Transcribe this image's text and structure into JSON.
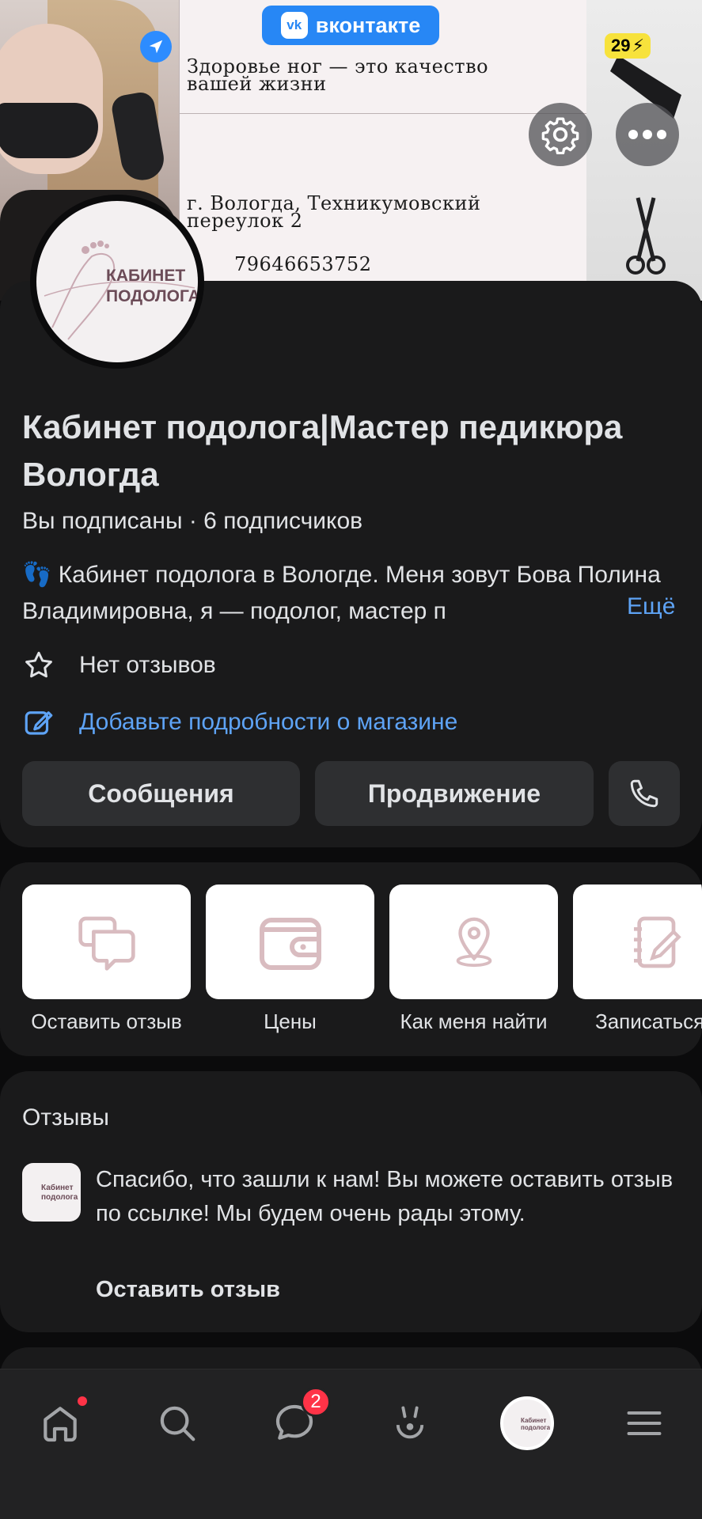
{
  "status_bar": {
    "battery": "29"
  },
  "cover": {
    "badge_label": "вконтакте",
    "slogan": "Здоровье ног — это качество вашей жизни",
    "address": "г. Вологда, Техникумовский переулок 2",
    "phone": "79646653752"
  },
  "avatar": {
    "text": "КАБИНЕТ ПОДОЛОГА"
  },
  "group": {
    "title": "Кабинет подолога|Мастер педикюра Вологда",
    "subscription_status": "Вы подписаны",
    "subscribers": "6 подписчиков",
    "description": "👣 Кабинет подолога в Вологде. Меня зовут Бова Полина Владимировна, я — подолог, мастер п",
    "more_label": "Ещё",
    "rating_text": "Нет отзывов",
    "shop_details_link": "Добавьте подробности о магазине"
  },
  "actions": {
    "messages_label": "Сообщения",
    "promotion_label": "Продвижение",
    "call_icon": "phone-icon"
  },
  "quick_actions": [
    {
      "label": "Оставить отзыв",
      "icon": "chat-bubbles-icon"
    },
    {
      "label": "Цены",
      "icon": "wallet-icon"
    },
    {
      "label": "Как меня найти",
      "icon": "map-pin-icon"
    },
    {
      "label": "Записаться",
      "icon": "notebook-icon"
    }
  ],
  "reviews": {
    "title": "Отзывы",
    "avatar_text": "Кабинет подолога",
    "message": "Спасибо, что зашли к нам! Вы можете оставить отзыв по ссылке! Мы будем очень рады этому.",
    "link_label": "Оставить отзыв"
  },
  "tabbar": {
    "messages_badge": "2",
    "avatar_text": "Кабинет подолога"
  },
  "colors": {
    "accent": "#5ea3f5",
    "vk_blue": "#2787f5",
    "badge_red": "#ff3347",
    "icon_pink": "#d9bcc0"
  }
}
